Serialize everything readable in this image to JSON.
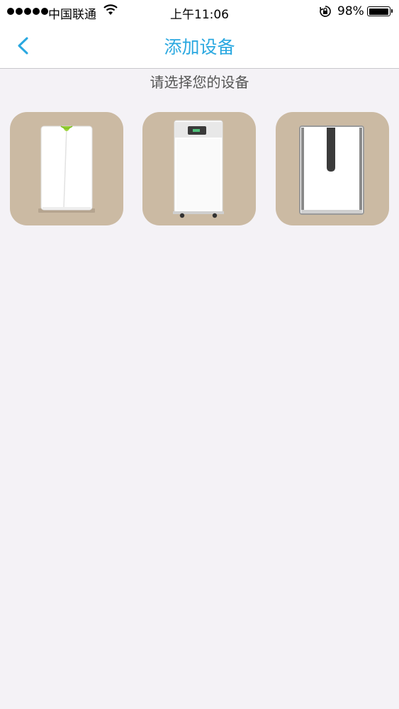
{
  "status_bar": {
    "carrier": "中国联通",
    "time": "上午11:06",
    "battery": "98%",
    "battery_level": 0.98
  },
  "nav": {
    "title": "添加设备",
    "back_icon": "chevron-left-icon",
    "accent_color": "#2aa8e0"
  },
  "prompt": "请选择您的设备",
  "devices": [
    {
      "icon": "air-purifier-green-accent-icon"
    },
    {
      "icon": "air-purifier-display-panel-icon"
    },
    {
      "icon": "air-purifier-dark-stripe-icon"
    }
  ],
  "colors": {
    "card_background": "#cbbaa3",
    "page_background": "#f4f2f6"
  }
}
